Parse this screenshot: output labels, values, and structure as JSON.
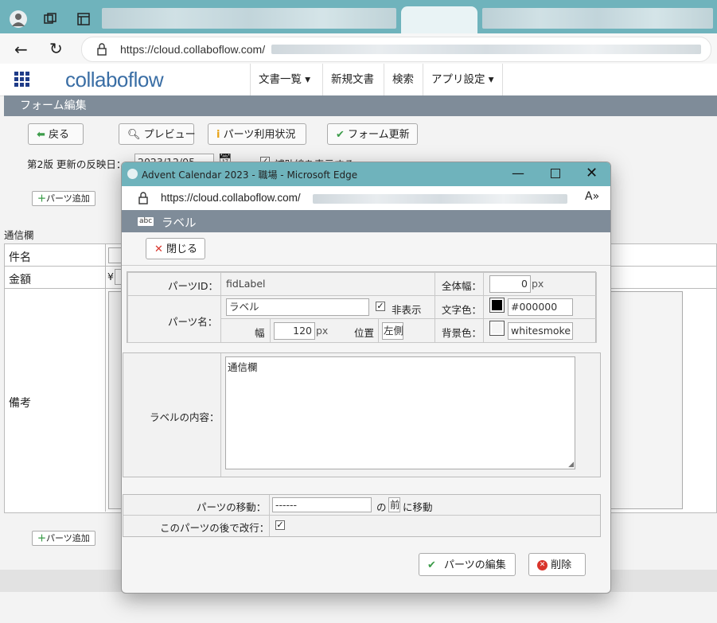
{
  "browser": {
    "url": "https://cloud.collaboflow.com/"
  },
  "app": {
    "logo": "collaboflow",
    "nav": [
      {
        "label": "文書一覧",
        "has_dropdown": true
      },
      {
        "label": "新規文書",
        "has_dropdown": false
      },
      {
        "label": "検索",
        "has_dropdown": false
      },
      {
        "label": "アプリ設定",
        "has_dropdown": true
      }
    ],
    "section_title": "フォーム編集",
    "toolbar": {
      "back": "戻る",
      "preview": "プレビュー",
      "parts_usage": "パーツ利用状況",
      "form_update": "フォーム更新"
    },
    "version_label": "第2版 更新の反映日：",
    "version_date": "2023/12/05",
    "grid_label": "補助線を表示する",
    "add_parts": "パーツ追加",
    "section_label": "通信欄",
    "rows": [
      "件名",
      "金額",
      "備考"
    ],
    "currency": "¥"
  },
  "dialog": {
    "window_title": "Advent Calendar 2023 - 職場 - Microsoft Edge",
    "url": "https://cloud.collaboflow.com/",
    "header_icon": "abc",
    "header_title": "ラベル",
    "close_label": "閉じる",
    "parts_id_label": "パーツID：",
    "parts_id_value": "fidLabel",
    "total_width_label": "全体幅：",
    "total_width_value": "0",
    "px": "px",
    "parts_name_label": "パーツ名：",
    "parts_name_value": "ラベル",
    "hide_label": "非表示",
    "hide_checked": true,
    "text_color_label": "文字色：",
    "text_color_value": "#000000",
    "width_label": "幅",
    "width_value": "120",
    "position_label": "位置",
    "position_value": "左側",
    "bg_color_label": "背景色：",
    "bg_color_value": "whitesmoke",
    "content_label": "ラベルの内容：",
    "content_value": "通信欄",
    "move_label": "パーツの移動：",
    "move_value": "------",
    "move_of": "の",
    "move_before": "前",
    "move_to": "に移動",
    "newline_label": "このパーツの後で改行：",
    "newline_checked": true,
    "edit_button": "パーツの編集",
    "delete_button": "削除"
  },
  "colors": {
    "titlebar": "#6fb3bc",
    "section_bar": "#7f8c99",
    "accent_green": "#3c9c4a",
    "accent_red": "#d9342b"
  }
}
